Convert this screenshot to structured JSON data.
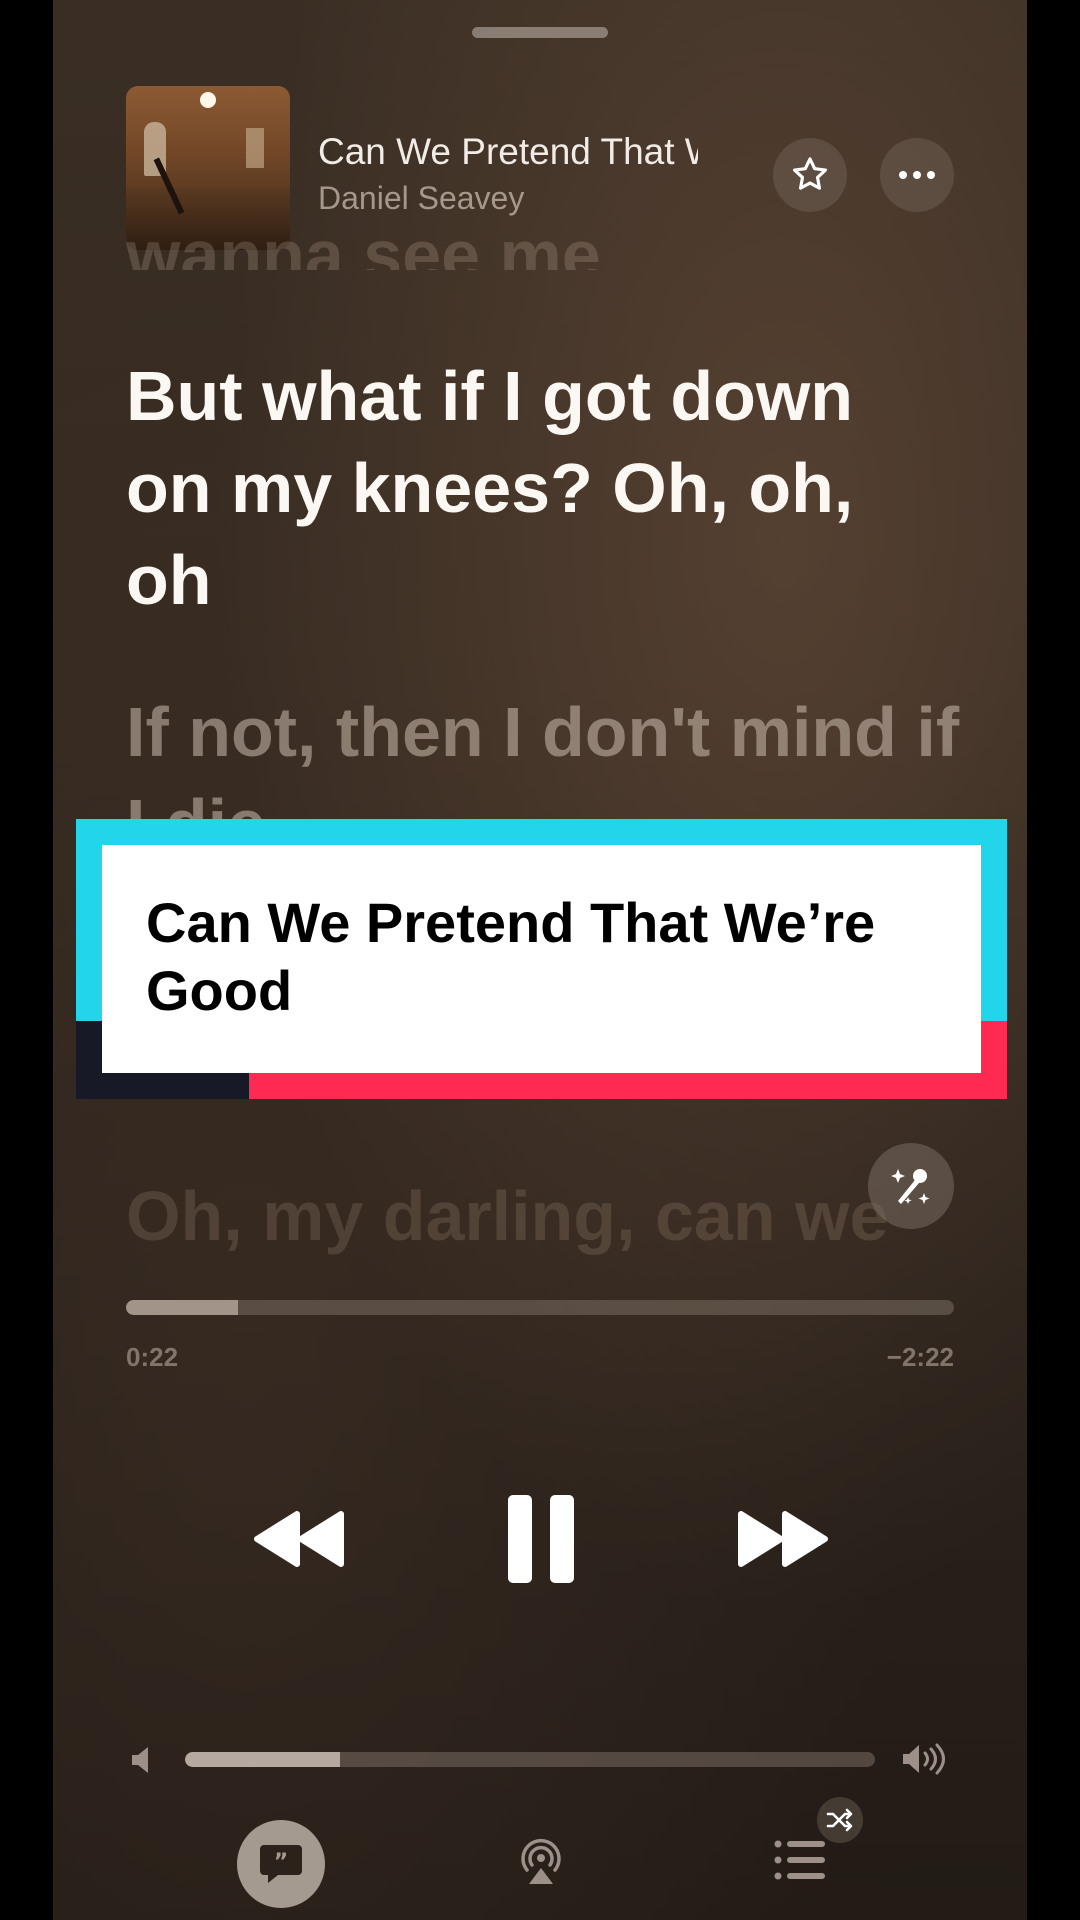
{
  "now_playing": {
    "title": "Can We Pretend That We’re Good",
    "artist": "Daniel Seavey"
  },
  "header": {
    "favorite_icon": "star-icon",
    "more_icon": "ellipsis-icon"
  },
  "lyrics": {
    "previous_fragment": "wanna see me",
    "active": "But what if I got down on my knees? Oh, oh, oh",
    "next": "If not, then I don't mind if I die",
    "upcoming": "Oh, my darling, can we"
  },
  "overlay_card": {
    "text": "Can We Pretend That We’re Good",
    "colors": {
      "cyan": "#22d5ea",
      "red": "#ff2a52",
      "dark": "#171927"
    }
  },
  "sing_button_icon": "microphone-sparkle-icon",
  "playback": {
    "elapsed": "0:22",
    "remaining": "−2:22",
    "progress_fraction": 0.135
  },
  "transport": {
    "rewind_icon": "rewind-icon",
    "pause_icon": "pause-icon",
    "forward_icon": "fast-forward-icon"
  },
  "volume": {
    "level_fraction": 0.225
  },
  "bottom_bar": {
    "lyrics_icon": "lyrics-quote-icon",
    "airplay_icon": "airplay-icon",
    "queue_icon": "queue-list-icon",
    "shuffle_icon": "shuffle-icon"
  }
}
